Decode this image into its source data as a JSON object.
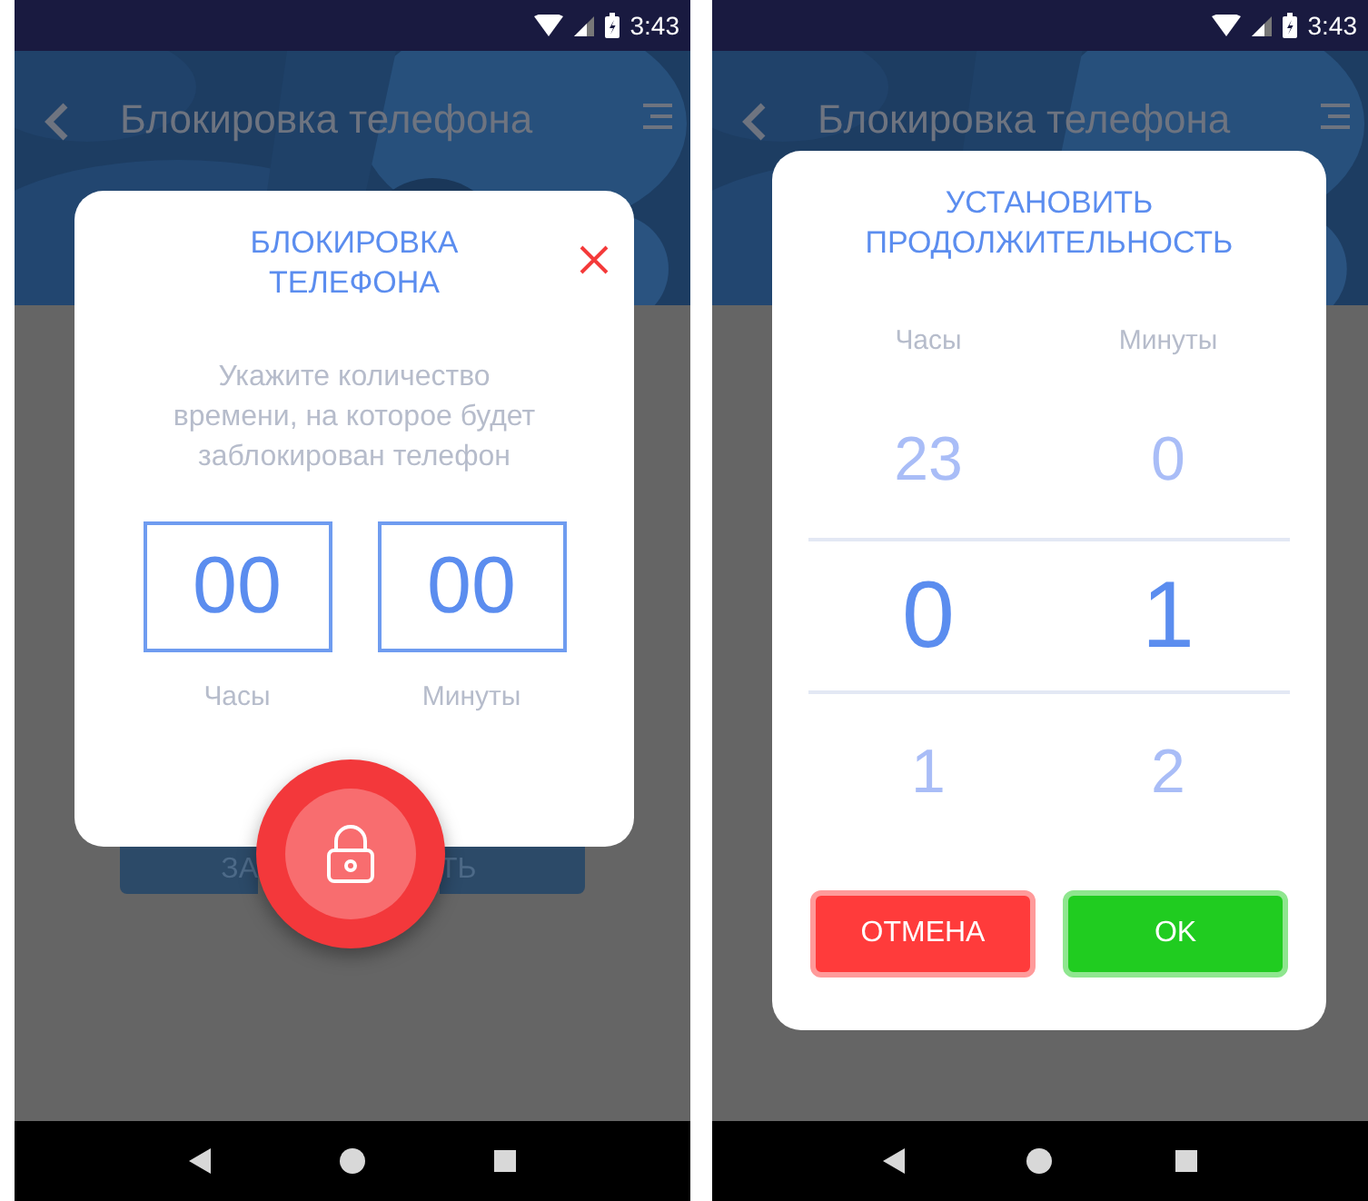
{
  "screens": [
    {
      "kind": "lock",
      "status_bar": {
        "time": "3:43"
      },
      "app_bar": {
        "title": "Блокировка телефона"
      },
      "background_button": {
        "label_parts": [
          "ЗА",
          "ТЬ"
        ]
      },
      "dialog": {
        "title": "БЛОКИРОВКА ТЕЛЕФОНА",
        "description": "Укажите количество времени, на которое будет заблокирован телефон",
        "fields": [
          {
            "value": "00",
            "label": "Часы"
          },
          {
            "value": "00",
            "label": "Минуты"
          }
        ]
      }
    },
    {
      "kind": "duration",
      "status_bar": {
        "time": "3:43"
      },
      "app_bar": {
        "title": "Блокировка телефона"
      },
      "dialog": {
        "title": "УСТАНОВИТЬ ПРОДОЛЖИТЕЛЬНОСТЬ",
        "columns": [
          {
            "label": "Часы",
            "values": [
              {
                "text": "23",
                "selected": false
              },
              {
                "text": "0",
                "selected": true
              },
              {
                "text": "1",
                "selected": false
              }
            ]
          },
          {
            "label": "Минуты",
            "values": [
              {
                "text": "0",
                "selected": false
              },
              {
                "text": "1",
                "selected": true
              },
              {
                "text": "2",
                "selected": false
              }
            ]
          }
        ],
        "buttons": [
          {
            "label": "ОТМЕНА",
            "kind": "cancel"
          },
          {
            "label": "OK",
            "kind": "confirm"
          }
        ]
      }
    }
  ]
}
